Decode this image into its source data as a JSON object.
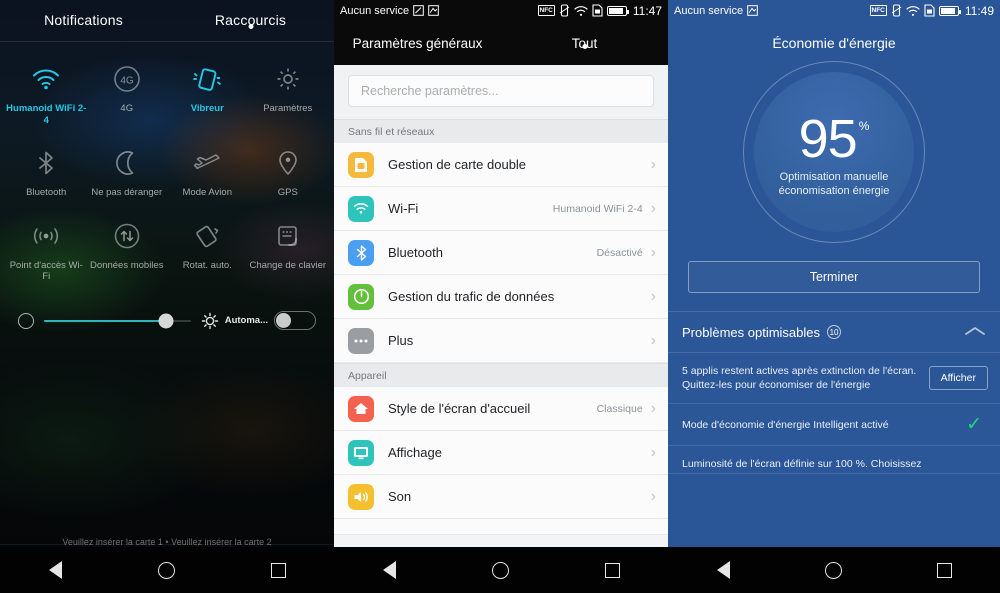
{
  "panel1": {
    "tabs": [
      {
        "label": "Notifications",
        "active": false
      },
      {
        "label": "Raccourcis",
        "active": true
      }
    ],
    "quick_settings": [
      {
        "label": "Humanoid WiFi 2-4",
        "icon": "wifi-icon",
        "on": true
      },
      {
        "label": "4G",
        "icon": "4g-icon",
        "on": false
      },
      {
        "label": "Vibreur",
        "icon": "vibrate-icon",
        "on": true
      },
      {
        "label": "Paramètres",
        "icon": "gear-icon",
        "on": false
      },
      {
        "label": "Bluetooth",
        "icon": "bluetooth-icon",
        "on": false
      },
      {
        "label": "Ne pas déranger",
        "icon": "moon-icon",
        "on": false
      },
      {
        "label": "Mode Avion",
        "icon": "airplane-icon",
        "on": false
      },
      {
        "label": "GPS",
        "icon": "location-pin-icon",
        "on": false
      },
      {
        "label": "Point d'accès Wi-Fi",
        "icon": "hotspot-icon",
        "on": false
      },
      {
        "label": "Données mobiles",
        "icon": "mobile-data-icon",
        "on": false
      },
      {
        "label": "Rotat. auto.",
        "icon": "auto-rotate-icon",
        "on": false
      },
      {
        "label": "Change de clavier",
        "icon": "keyboard-switch-icon",
        "on": false
      }
    ],
    "brightness": {
      "percent": 83,
      "auto_label": "Automa...",
      "auto_on": false
    },
    "sim_message": "Veuillez insérer la carte 1 • Veuillez insérer la carte 2",
    "accent_color": "#24c9e8",
    "slider_color": "#2fb6bd"
  },
  "panel2": {
    "statusbar": {
      "carrier": "Aucun service",
      "time": "11:47",
      "left_icons": [
        "screenshot-icon",
        "sync-icon"
      ],
      "right_icons": [
        "nfc-icon",
        "vibrate-icon",
        "wifi-icon",
        "sim-icon",
        "battery-icon"
      ]
    },
    "tabs": [
      {
        "label": "Paramètres généraux",
        "active": false
      },
      {
        "label": "Tout",
        "active": true
      }
    ],
    "search": {
      "placeholder": "Recherche paramètres..."
    },
    "sections": [
      {
        "title": "Sans fil et réseaux",
        "rows": [
          {
            "label": "Gestion de carte double",
            "value": "",
            "icon": "sim-card-icon",
            "color": "#f6b93b"
          },
          {
            "label": "Wi-Fi",
            "value": "Humanoid WiFi 2-4",
            "icon": "wifi-icon",
            "color": "#2ec4bc"
          },
          {
            "label": "Bluetooth",
            "value": "Désactivé",
            "icon": "bluetooth-icon",
            "color": "#4a9ff0"
          },
          {
            "label": "Gestion du trafic de données",
            "value": "",
            "icon": "data-traffic-icon",
            "color": "#63bf3c"
          },
          {
            "label": "Plus",
            "value": "",
            "icon": "more-icon",
            "color": "#9a9ea2"
          }
        ]
      },
      {
        "title": "Appareil",
        "rows": [
          {
            "label": "Style de l'écran d'accueil",
            "value": "Classique",
            "icon": "home-icon",
            "color": "#f4614f"
          },
          {
            "label": "Affichage",
            "value": "",
            "icon": "display-icon",
            "color": "#2ec4bc"
          },
          {
            "label": "Son",
            "value": "",
            "icon": "sound-icon",
            "color": "#f5c02f"
          }
        ]
      }
    ]
  },
  "panel3": {
    "statusbar": {
      "carrier": "Aucun service",
      "time": "11:49",
      "left_icons": [
        "sync-icon"
      ],
      "right_icons": [
        "nfc-icon",
        "vibrate-icon",
        "wifi-icon",
        "sim-icon",
        "battery-icon"
      ]
    },
    "title": "Économie d'énergie",
    "gauge": {
      "value": "95",
      "unit": "%",
      "caption_line1": "Optimisation manuelle",
      "caption_line2": "économisation énergie"
    },
    "done_button": "Terminer",
    "problems": {
      "header": "Problèmes optimisables",
      "count": "10",
      "collapse_icon": "chevron-up-icon",
      "items": [
        {
          "text": "5 applis restent actives après extinction de l'écran. Quittez-les pour économiser de l'énergie",
          "action": "Afficher",
          "type": "action"
        },
        {
          "text": "Mode d'économie d'énergie Intelligent activé",
          "action": "",
          "type": "check"
        },
        {
          "text": "Luminosité de l'écran définie sur 100 %. Choisissez",
          "action": "",
          "type": "action"
        }
      ]
    },
    "bg_color": "#2a5596",
    "check_color": "#1fd97a"
  },
  "navbar": {
    "buttons": [
      {
        "name": "back",
        "icon": "back-triangle-icon"
      },
      {
        "name": "home",
        "icon": "home-circle-icon"
      },
      {
        "name": "recents",
        "icon": "recents-square-icon"
      }
    ]
  }
}
